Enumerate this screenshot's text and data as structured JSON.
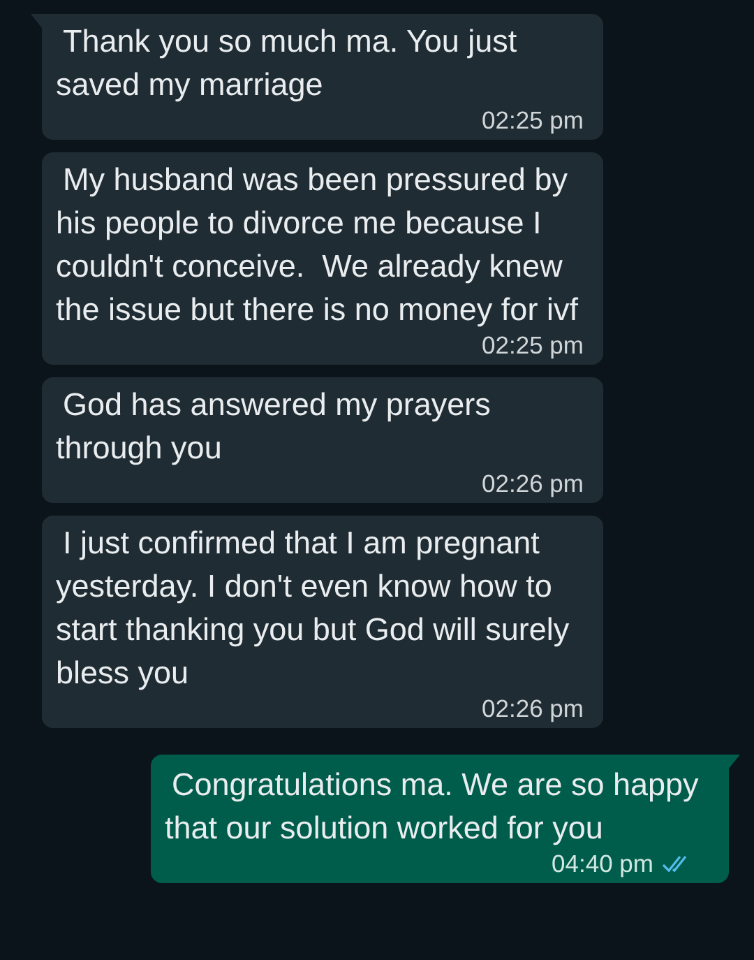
{
  "messages": [
    {
      "kind": "received",
      "text": "Thank you so much ma. You just saved my marriage",
      "time": "02:25 pm",
      "tail": true
    },
    {
      "kind": "received",
      "text": "My husband was been pressured by his people to divorce me because I couldn't conceive.  We already knew the issue but there is no money for ivf",
      "time": "02:25 pm",
      "tail": false
    },
    {
      "kind": "received",
      "text": "God has answered my prayers through you",
      "time": "02:26 pm",
      "tail": false
    },
    {
      "kind": "received",
      "text": "I just confirmed that I am pregnant yesterday. I don't even know how to start thanking you but God will surely bless you",
      "time": "02:26 pm",
      "tail": false
    },
    {
      "kind": "sent",
      "text": "Congratulations ma. We are so happy that our solution worked for you",
      "time": "04:40 pm",
      "tail": true,
      "read": true
    }
  ]
}
